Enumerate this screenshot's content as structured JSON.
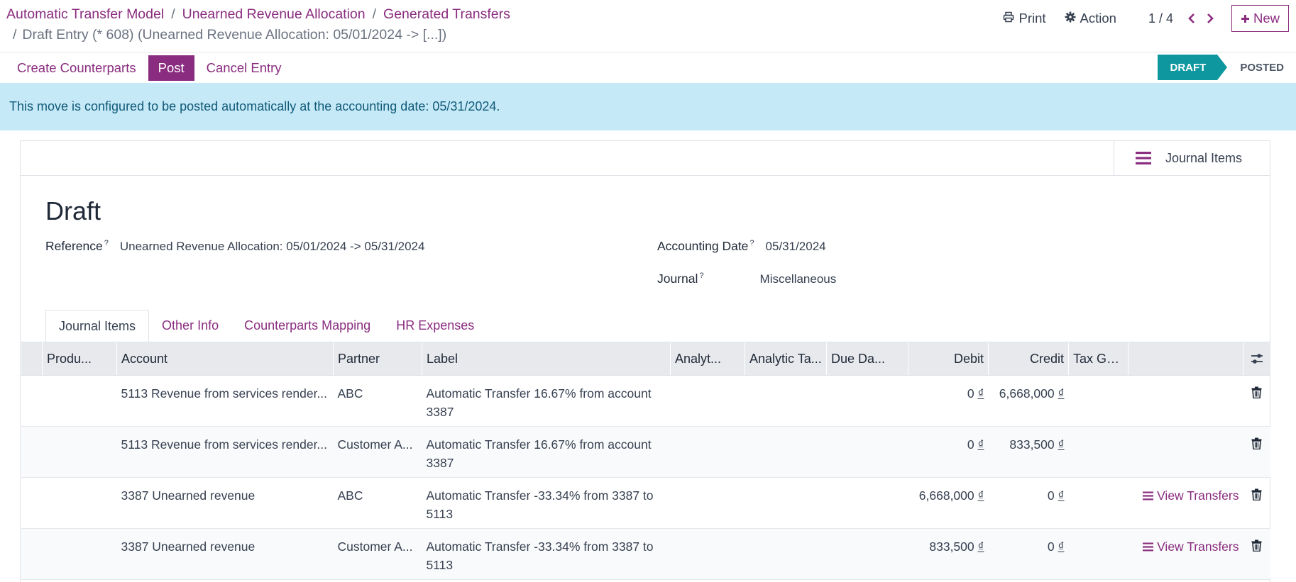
{
  "breadcrumb": {
    "items": [
      "Automatic Transfer Model",
      "Unearned Revenue Allocation",
      "Generated Transfers"
    ],
    "separator": "/",
    "current": "Draft Entry (* 608) (Unearned Revenue Allocation: 05/01/2024 -> [...])"
  },
  "topbar": {
    "print_label": "Print",
    "action_label": "Action",
    "pager": "1 / 4",
    "new_label": "New"
  },
  "statusbar": {
    "buttons": [
      "Create Counterparts",
      "Post",
      "Cancel Entry"
    ],
    "stages": [
      "DRAFT",
      "POSTED"
    ],
    "active_stage": "DRAFT"
  },
  "alert": {
    "text": "This move is configured to be posted automatically at the accounting date: 05/31/2024."
  },
  "smart_button": {
    "label": "Journal Items"
  },
  "form": {
    "title": "Draft",
    "reference_label": "Reference",
    "reference_value": "Unearned Revenue Allocation: 05/01/2024 -> 05/31/2024",
    "accounting_date_label": "Accounting Date",
    "accounting_date_value": "05/31/2024",
    "journal_label": "Journal",
    "journal_value": "Miscellaneous",
    "help_mark": "?"
  },
  "tabs": [
    "Journal Items",
    "Other Info",
    "Counterparts Mapping",
    "HR Expenses"
  ],
  "table": {
    "columns": [
      "Produ...",
      "Account",
      "Partner",
      "Label",
      "Analyt...",
      "Analytic Ta...",
      "Due Da...",
      "Debit",
      "Credit",
      "Tax Gri..."
    ],
    "rows": [
      {
        "account": "5113 Revenue from services render...",
        "partner": "ABC",
        "label": "Automatic Transfer 16.67% from account 3387",
        "debit": "0",
        "credit": "6,668,000",
        "action": ""
      },
      {
        "account": "5113 Revenue from services render...",
        "partner": "Customer A...",
        "label": "Automatic Transfer 16.67% from account 3387",
        "debit": "0",
        "credit": "833,500",
        "action": ""
      },
      {
        "account": "3387 Unearned revenue",
        "partner": "ABC",
        "label": "Automatic Transfer -33.34% from 3387 to 5113",
        "debit": "6,668,000",
        "credit": "0",
        "action": "View Transfers"
      },
      {
        "account": "3387 Unearned revenue",
        "partner": "Customer A...",
        "label": "Automatic Transfer -33.34% from 3387 to 5113",
        "debit": "833,500",
        "credit": "0",
        "action": "View Transfers"
      }
    ],
    "currency_symbol": "₫"
  },
  "colors": {
    "accent": "#8a2c7f",
    "stage_active": "#0f97a0",
    "alert_bg": "#c5e9f7"
  }
}
